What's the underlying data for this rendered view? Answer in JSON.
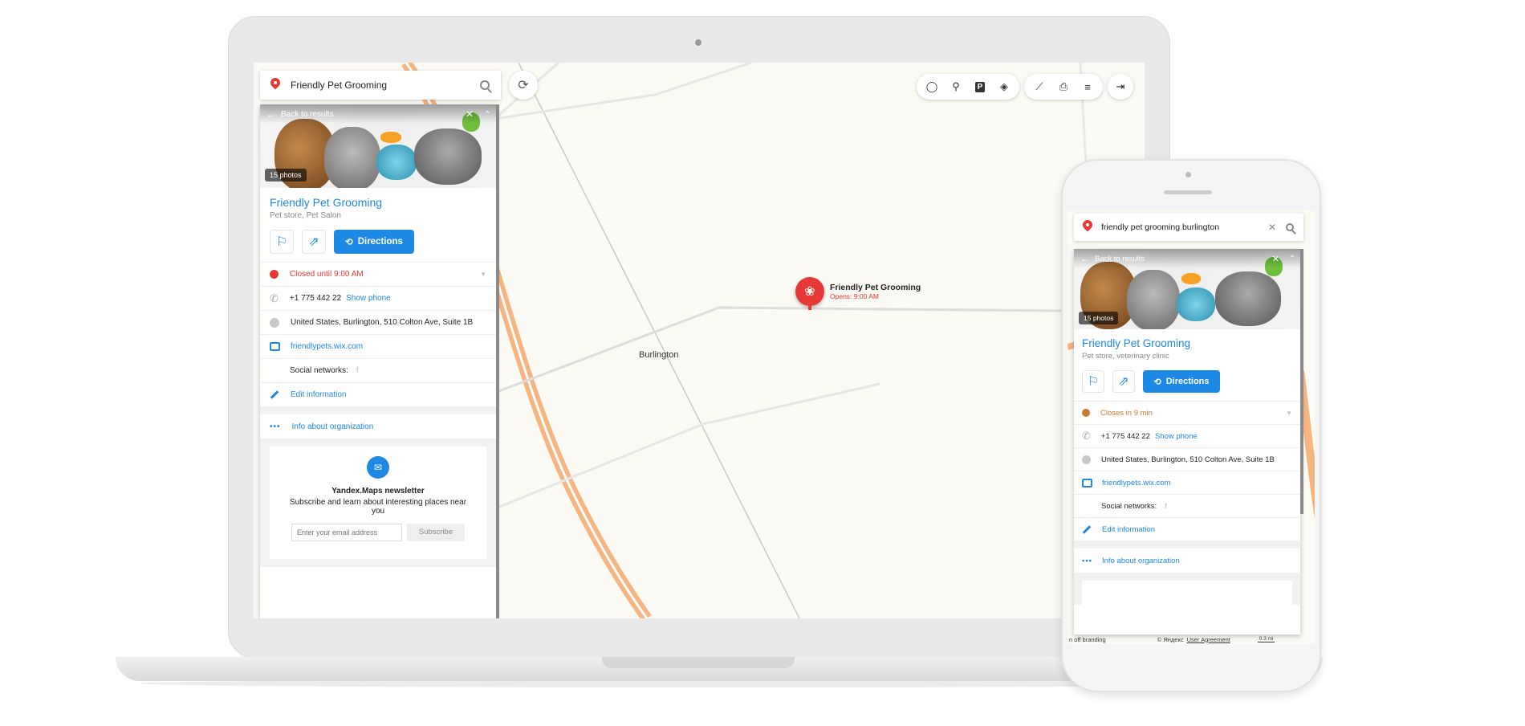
{
  "desktop": {
    "search": {
      "value": "Friendly Pet Grooming"
    },
    "card": {
      "back_label": "Back to results",
      "photos_count": "15 photos",
      "title": "Friendly Pet Grooming",
      "subtitle": "Pet store, Pet Salon",
      "directions_label": "Directions",
      "hours": "Closed until 9:00 AM",
      "phone": "+1 775 442 22",
      "show_phone": "Show phone",
      "address": "United States, Burlington, 510 Colton Ave, Suite 1B",
      "website": "friendlypets.wix.com",
      "social_label": "Social networks:",
      "social_icon": "f",
      "edit_label": "Edit information",
      "info_label": "Info about organization"
    },
    "newsletter": {
      "title": "Yandex.Maps newsletter",
      "text": "Subscribe and learn about interesting places near you",
      "email_placeholder": "Enter your email address",
      "subscribe_label": "Subscribe"
    },
    "map": {
      "pin_title": "Friendly Pet Grooming",
      "pin_subtitle": "Opens: 9:00 AM",
      "city_label": "Burlington"
    },
    "toolbar": {
      "icons": [
        "traffic-icon",
        "bike-icon",
        "parking-icon",
        "layers-icon",
        "ruler-icon",
        "print-icon",
        "menu-icon",
        "login-icon"
      ]
    }
  },
  "mobile": {
    "search": {
      "value": "friendly pet grooming burlington"
    },
    "card": {
      "back_label": "Back to results",
      "photos_count": "15 photos",
      "title": "Friendly Pet Grooming",
      "subtitle": "Pet store, veterinary clinic",
      "directions_label": "Directions",
      "hours": "Closes in 9 min",
      "phone": "+1 775 442 22",
      "show_phone": "Show phone",
      "address": "United States, Burlington, 510 Colton Ave, Suite 1B",
      "website": "friendlypets.wix.com",
      "social_label": "Social networks:",
      "social_icon": "f",
      "edit_label": "Edit information",
      "info_label": "Info about organization"
    },
    "footer": {
      "branding": "n off branding",
      "copyright": "© Яндекс",
      "agreement": "User Agreement",
      "scale": "0.3 mi"
    }
  },
  "colors": {
    "accent": "#1e88e5",
    "pin": "#e53935",
    "road": "#f5b07a",
    "closed": "#e53935",
    "closing": "#c77b30"
  }
}
